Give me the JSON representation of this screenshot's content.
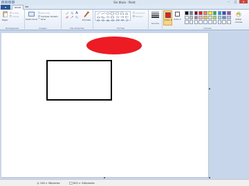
{
  "window": {
    "title": "Sin título - Paint",
    "minimize": "–",
    "maximize": "□",
    "close": "✕"
  },
  "tabs": {
    "file": "▾",
    "home": "Inicio",
    "view": "Ver"
  },
  "ribbon": {
    "clipboard": {
      "paste": "Pegar",
      "cut": "Cortar",
      "copy": "Copiar",
      "label": "Portapapeles"
    },
    "image": {
      "select": "Seleccionar",
      "crop": "Recortar",
      "resize": "Cambiar tamaño",
      "rotate": "Girar",
      "label": "Imagen"
    },
    "tools": {
      "label": "Herramientas",
      "brushes": "Pinceles"
    },
    "shapes": {
      "outline": "Contorno",
      "fill": "Relleno",
      "label": "Formas"
    },
    "size": {
      "label": "Tamaño"
    },
    "color1": {
      "label": "Color 1",
      "value": "#ed1c24"
    },
    "color2": {
      "label": "Color 2",
      "value": "#ffffff"
    },
    "colors": {
      "edit": "Editar colores",
      "label": "Colores",
      "palette": [
        "#000000",
        "#7f7f7f",
        "#880015",
        "#ed1c24",
        "#ff7f27",
        "#fff200",
        "#22b14c",
        "#00a2e8",
        "#3f48cc",
        "#a349a4",
        "#ffffff",
        "#c3c3c3",
        "#b97a57",
        "#ffaec9",
        "#ffc90e",
        "#efe4b0",
        "#b5e61d",
        "#99d9ea",
        "#7092be",
        "#c8bfe7"
      ]
    }
  },
  "canvas": {
    "ellipse_fill": "#ed1c24",
    "rect_stroke": "#000000"
  },
  "status": {
    "cursor": "246 × 96píxeles",
    "canvas_size": "800 × 546píxeles"
  }
}
